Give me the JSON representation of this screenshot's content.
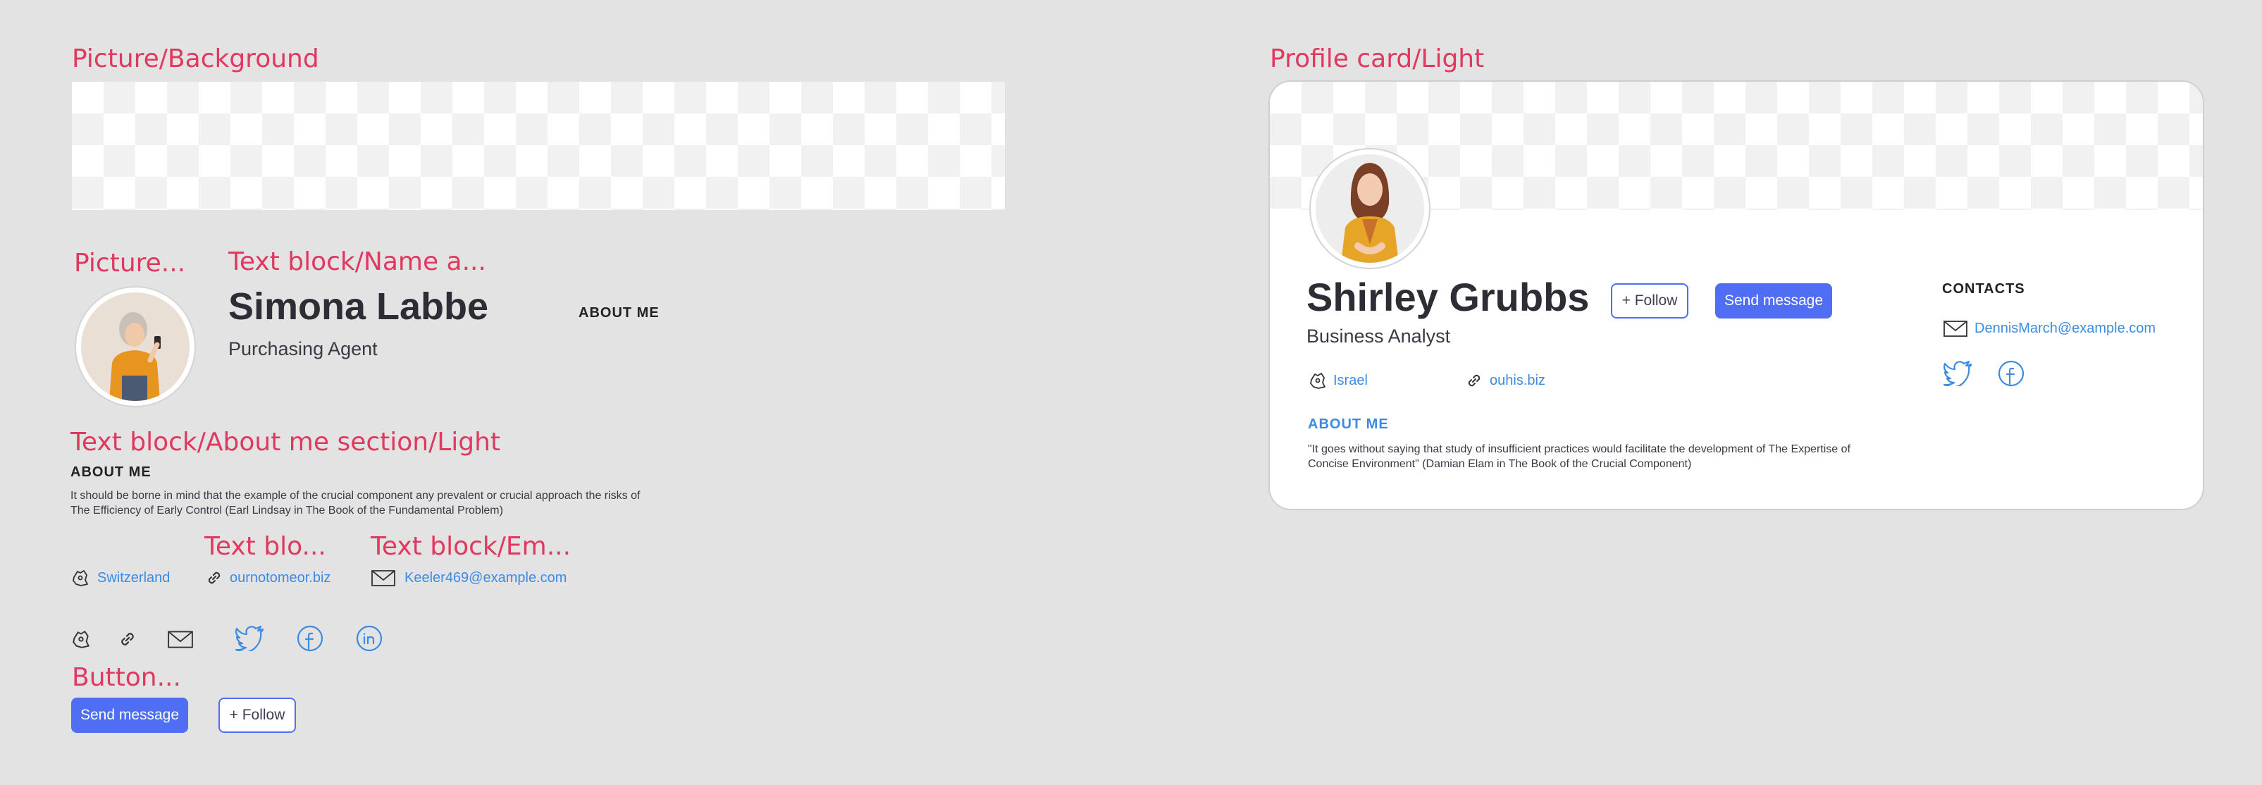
{
  "labels": {
    "picture_background": "Picture/Background",
    "picture": "Picture...",
    "name_block": "Text block/Name a...",
    "about_section": "Text block/About me section/Light",
    "text_blo": "Text blo...",
    "text_em": "Text block/Em...",
    "button": "Button...",
    "profile_card": "Profile card/Light"
  },
  "left": {
    "name": "Simona Labbe",
    "role": "Purchasing Agent",
    "about_me_top": "ABOUT ME",
    "about_heading": "ABOUT ME",
    "about_text": "It should be borne in mind that the example of the crucial component any prevalent or crucial approach the risks of The Efficiency of Early Control (Earl Lindsay in The Book of the Fundamental Problem)",
    "location": "Switzerland",
    "website": "ournotomeor.biz",
    "email": "Keeler469@example.com",
    "send_message": "Send message",
    "follow": "+ Follow"
  },
  "card": {
    "name": "Shirley Grubbs",
    "role": "Business Analyst",
    "follow": "+ Follow",
    "send_message": "Send message",
    "contacts_heading": "CONTACTS",
    "email": "DennisMarch@example.com",
    "location": "Israel",
    "website": "ouhis.biz",
    "about_heading": "ABOUT ME",
    "about_text": "\"It goes without saying that study of insufficient practices would facilitate the development of The Expertise of Concise Environment\" (Damian Elam in The Book of the Crucial Component)"
  },
  "colors": {
    "accent": "#4f6ef3",
    "link": "#3d8be0",
    "label": "#e0385f",
    "background": "#e3e3e3"
  },
  "icons": [
    "location-icon",
    "link-icon",
    "mail-icon",
    "twitter-icon",
    "facebook-icon",
    "linkedin-icon",
    "plus-icon"
  ]
}
